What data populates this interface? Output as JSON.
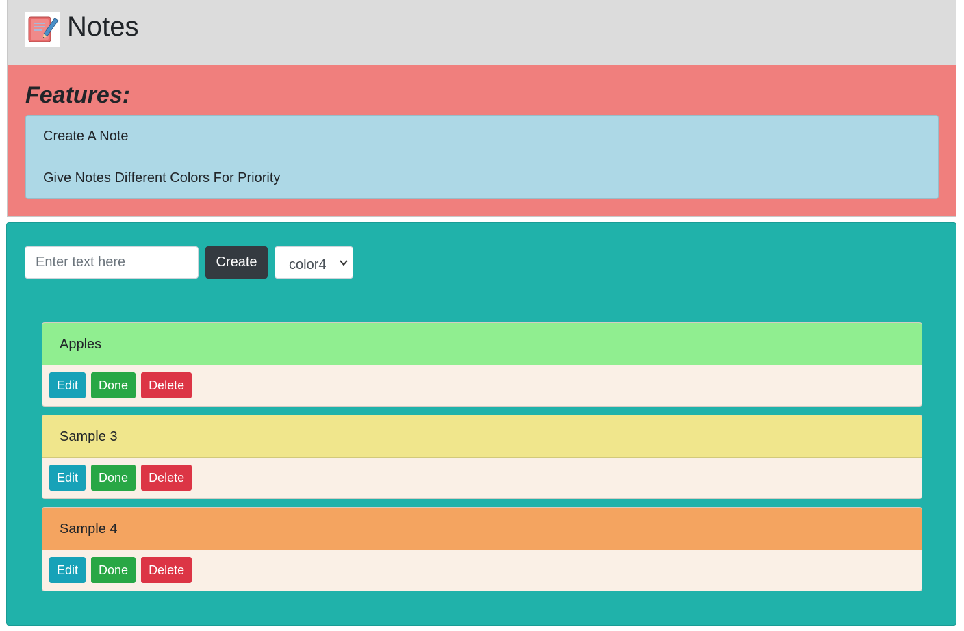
{
  "header": {
    "title": "Notes",
    "logo_icon": "notepad-pencil-icon"
  },
  "features": {
    "title": "Features:",
    "items": [
      {
        "label": "Create A Note"
      },
      {
        "label": "Give Notes Different Colors For Priority"
      }
    ]
  },
  "form": {
    "input_value": "",
    "input_placeholder": "Enter text here",
    "create_label": "Create",
    "color_selected": "color4"
  },
  "notes": [
    {
      "text": "Apples",
      "color": "#90ee90",
      "edit_label": "Edit",
      "done_label": "Done",
      "delete_label": "Delete"
    },
    {
      "text": "Sample 3",
      "color": "#f0e68c",
      "edit_label": "Edit",
      "done_label": "Done",
      "delete_label": "Delete"
    },
    {
      "text": "Sample 4",
      "color": "#f4a460",
      "edit_label": "Edit",
      "done_label": "Done",
      "delete_label": "Delete"
    }
  ],
  "colors": {
    "header_bg": "#dcdcdc",
    "features_bg": "#f07f7d",
    "feature_list_bg": "#add8e6",
    "main_bg": "#20b2aa",
    "note_body_bg": "#faf0e6",
    "edit": "#17a2b8",
    "done": "#28a745",
    "delete": "#dc3545",
    "create": "#343a40"
  }
}
